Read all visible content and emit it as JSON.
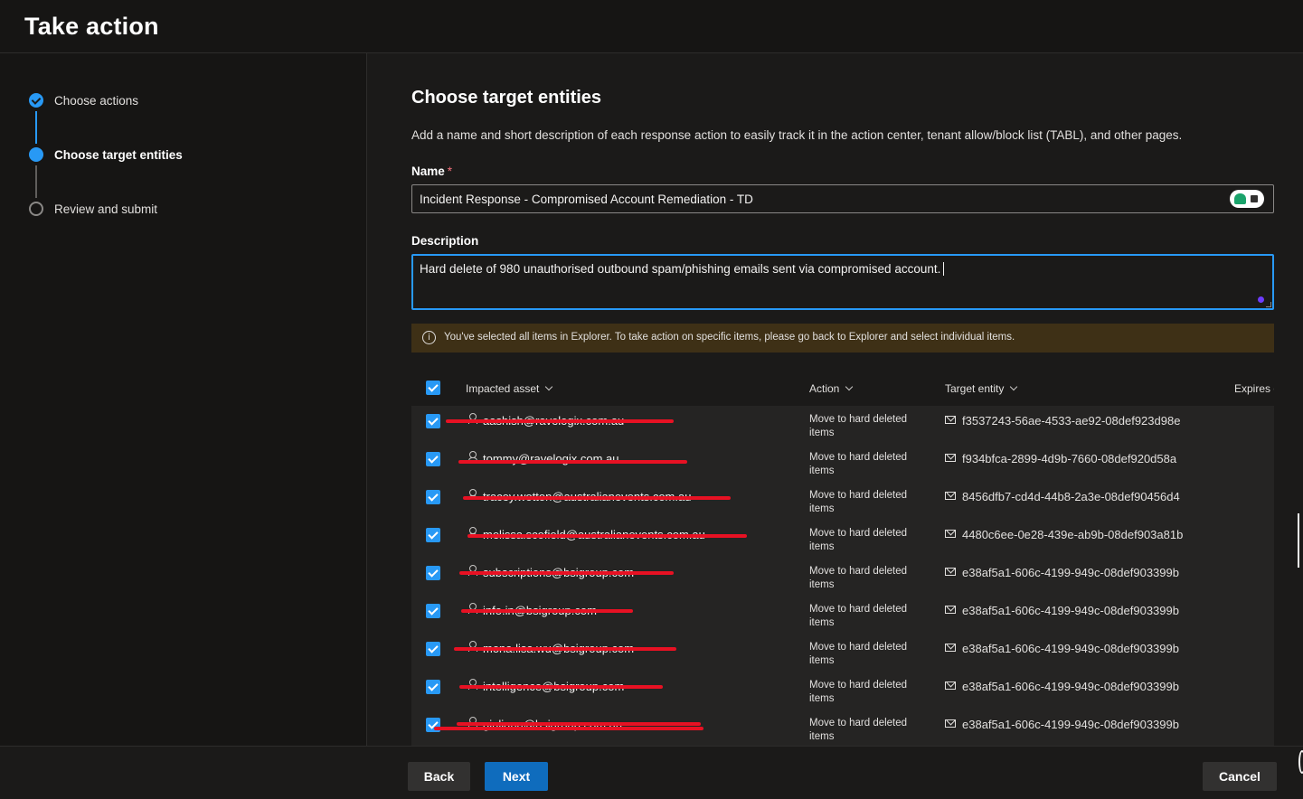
{
  "header": {
    "title": "Take action"
  },
  "steps": [
    {
      "label": "Choose actions",
      "state": "done"
    },
    {
      "label": "Choose target entities",
      "state": "current"
    },
    {
      "label": "Review and submit",
      "state": "todo"
    }
  ],
  "main": {
    "title": "Choose target entities",
    "description": "Add a name and short description of each response action to easily track it in the action center, tenant allow/block list (TABL), and other pages.",
    "name_label": "Name",
    "name_required": "*",
    "name_value": "Incident Response - Compromised Account Remediation - TD",
    "description_label": "Description",
    "description_value": "Hard delete of 980 unauthorised outbound spam/phishing emails sent via compromised account.",
    "banner": {
      "icon": "info-icon",
      "icon_glyph": "i",
      "message": "You've selected all items in Explorer. To take action on specific items, please go back to Explorer and select individual items."
    }
  },
  "table": {
    "columns": [
      "Impacted asset",
      "Action",
      "Target entity",
      "Expires o"
    ],
    "rows": [
      {
        "asset": "aashish@ravelogix.com.au",
        "action": "Move to hard deleted items",
        "target": "f3537243-56ae-4533-ae92-08def923d98e"
      },
      {
        "asset": "tommy@ravelogix.com.au",
        "action": "Move to hard deleted items",
        "target": "f934bfca-2899-4d9b-7660-08def920d58a"
      },
      {
        "asset": "tracey.wotton@australianevents.com.au",
        "action": "Move to hard deleted items",
        "target": "8456dfb7-cd4d-44b8-2a3e-08def90456d4"
      },
      {
        "asset": "melissa.scofield@australianevents.com.au",
        "action": "Move to hard deleted items",
        "target": "4480c6ee-0e28-439e-ab9b-08def903a81b"
      },
      {
        "asset": "subscriptions@bsigroup.com",
        "action": "Move to hard deleted items",
        "target": "e38af5a1-606c-4199-949c-08def903399b"
      },
      {
        "asset": "info.in@bsigroup.com",
        "action": "Move to hard deleted items",
        "target": "e38af5a1-606c-4199-949c-08def903399b"
      },
      {
        "asset": "mona.lisa.wu@bsigroup.com",
        "action": "Move to hard deleted items",
        "target": "e38af5a1-606c-4199-949c-08def903399b"
      },
      {
        "asset": "intelligence@bsigroup.com",
        "action": "Move to hard deleted items",
        "target": "e38af5a1-606c-4199-949c-08def903399b"
      },
      {
        "asset": "giuliana@bsigroup.com.au",
        "action": "Move to hard deleted items",
        "target": "e38af5a1-606c-4199-949c-08def903399b"
      }
    ]
  },
  "footer": {
    "back_label": "Back",
    "next_label": "Next",
    "cancel_label": "Cancel"
  },
  "colors": {
    "accent": "#2899f5",
    "primary_button": "#0f6cbd",
    "banner_bg": "#3e3016",
    "redaction": "#e81123"
  }
}
